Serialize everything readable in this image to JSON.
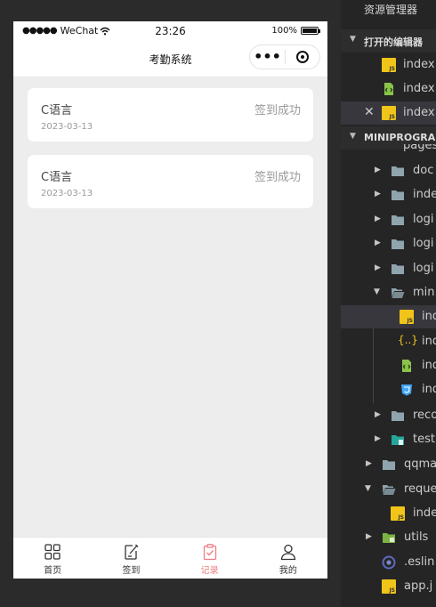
{
  "phone": {
    "status_bar": {
      "carrier": "WeChat",
      "time": "23:26",
      "battery": "100%"
    },
    "nav_title": "考勤系统",
    "records": [
      {
        "course": "C语言",
        "status": "签到成功",
        "date": "2023-03-13"
      },
      {
        "course": "C语言",
        "status": "签到成功",
        "date": "2023-03-13"
      }
    ],
    "tabs": [
      {
        "label": "首页",
        "icon": "grid-icon"
      },
      {
        "label": "签到",
        "icon": "edit-icon"
      },
      {
        "label": "记录",
        "icon": "clipboard-check-icon"
      },
      {
        "label": "我的",
        "icon": "user-icon"
      }
    ],
    "active_tab": "记录",
    "accent_color": "#f07c82"
  },
  "explorer": {
    "header": "资源管理器",
    "open_editors_title": "打开的编辑器",
    "open_editors": [
      "index",
      "index",
      "index"
    ],
    "project_title": "MINIPROGRA",
    "tree": [
      {
        "label": "pages"
      },
      {
        "label": "doc"
      },
      {
        "label": "inde"
      },
      {
        "label": "logi"
      },
      {
        "label": "logi"
      },
      {
        "label": "logi"
      },
      {
        "label": "min"
      },
      {
        "label": "ind"
      },
      {
        "label": "ind"
      },
      {
        "label": "ind"
      },
      {
        "label": "ind"
      },
      {
        "label": "reco"
      },
      {
        "label": "test"
      },
      {
        "label": "qqma"
      },
      {
        "label": "reque"
      },
      {
        "label": "inde"
      },
      {
        "label": "utils"
      },
      {
        "label": ".eslin"
      },
      {
        "label": "app.j"
      }
    ]
  }
}
